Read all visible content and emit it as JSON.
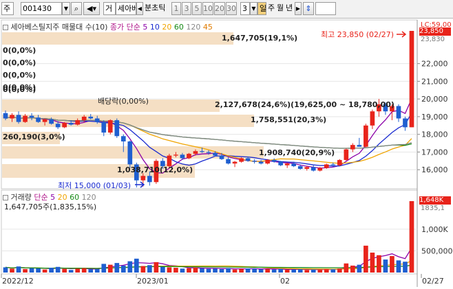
{
  "toolbar": {
    "market": "주",
    "code": "001430",
    "mode": "거",
    "name": "세아베",
    "period_label": "분초틱",
    "periods": [
      "1",
      "3",
      "5",
      "10",
      "20",
      "30"
    ],
    "period_value": "3",
    "day": "일",
    "week": "주",
    "month": "월",
    "year": "년"
  },
  "price_panel": {
    "legend_title": "세아베스틸지주 매물대 수(10)",
    "legend_ma_label": "종가 단순",
    "ma_periods": [
      {
        "label": "5",
        "color": "#8b00a8"
      },
      {
        "label": "10",
        "color": "#1a2bd0"
      },
      {
        "label": "20",
        "color": "#f0a400"
      },
      {
        "label": "60",
        "color": "#168a16"
      },
      {
        "label": "120",
        "color": "#888888"
      },
      {
        "label": "45",
        "color": "#e07b00"
      }
    ],
    "annotations": {
      "high": "최고 23,850 (02/27)",
      "low": "최저 15,000 (01/03)",
      "dividend": "배당락(0,00%)"
    },
    "zero_labels": [
      "0(0,0%)",
      "0(0,0%)",
      "0(0,0%)",
      "0(0,0%)",
      "0(0,0%)"
    ],
    "volume_profile": [
      {
        "label": "1,647,705(19,1%)"
      },
      {
        "label": "2,127,678(24,6%)(19,625,00 ~ 18,780,00)"
      },
      {
        "label": "1,758,551(20,3%)"
      },
      {
        "label": "260,190(3,0%)"
      },
      {
        "label": "1,908,740(20,9%)"
      },
      {
        "label": "1,038,710(12,0%)"
      }
    ],
    "y_ticks": [
      "22,000",
      "21,000",
      "20,000",
      "19,000",
      "18,000",
      "17,000",
      "16,000"
    ],
    "last_price_tag": "23,850",
    "ref_price_tag": "23,830",
    "top_partial_tag": "LC:59,00"
  },
  "volume_panel": {
    "legend_title": "거래량",
    "legend_ma_label": "단순",
    "ma_periods": [
      {
        "label": "5",
        "color": "#8b00a8"
      },
      {
        "label": "20",
        "color": "#f0a400"
      },
      {
        "label": "60",
        "color": "#168a16"
      },
      {
        "label": "120",
        "color": "#888888"
      }
    ],
    "value_line": "1,647,705주(1,835,15%)",
    "y_ticks": [
      "1,000K",
      "500,000"
    ],
    "last_volume_tag": "1,648K",
    "last_volume_pct_tag": "1835,1"
  },
  "x_axis": {
    "labels": [
      "2022/12",
      "2023/01",
      "02",
      "02/27"
    ]
  },
  "colors": {
    "up": "#e8241b",
    "down": "#1f5fd0",
    "profile": "#f5dfc4",
    "tag_red": "#e8241b"
  },
  "chart_data": {
    "type": "candlestick",
    "price_axis": {
      "min": 15000,
      "max": 23850
    },
    "candles": [
      {
        "o": 19200,
        "h": 19350,
        "l": 18800,
        "c": 18900
      },
      {
        "o": 18900,
        "h": 19200,
        "l": 18700,
        "c": 19100
      },
      {
        "o": 19100,
        "h": 19300,
        "l": 18600,
        "c": 18700
      },
      {
        "o": 18700,
        "h": 19150,
        "l": 18650,
        "c": 19050
      },
      {
        "o": 19050,
        "h": 19200,
        "l": 18800,
        "c": 18950
      },
      {
        "o": 18950,
        "h": 19100,
        "l": 18650,
        "c": 18700
      },
      {
        "o": 18700,
        "h": 18900,
        "l": 18500,
        "c": 18850
      },
      {
        "o": 18850,
        "h": 18950,
        "l": 18550,
        "c": 18600
      },
      {
        "o": 18600,
        "h": 18750,
        "l": 18300,
        "c": 18400
      },
      {
        "o": 18400,
        "h": 18700,
        "l": 18350,
        "c": 18650
      },
      {
        "o": 18650,
        "h": 18800,
        "l": 18500,
        "c": 18550
      },
      {
        "o": 18550,
        "h": 18900,
        "l": 18500,
        "c": 18800
      },
      {
        "o": 18800,
        "h": 19100,
        "l": 18700,
        "c": 19000
      },
      {
        "o": 19000,
        "h": 19150,
        "l": 18850,
        "c": 18900
      },
      {
        "o": 18900,
        "h": 19050,
        "l": 18600,
        "c": 18700
      },
      {
        "o": 18700,
        "h": 18800,
        "l": 17900,
        "c": 18100
      },
      {
        "o": 18100,
        "h": 18850,
        "l": 18000,
        "c": 18800
      },
      {
        "o": 18800,
        "h": 18900,
        "l": 17800,
        "c": 17900
      },
      {
        "o": 17900,
        "h": 18000,
        "l": 17000,
        "c": 17600
      },
      {
        "o": 17600,
        "h": 17650,
        "l": 16100,
        "c": 16300
      },
      {
        "o": 16300,
        "h": 16400,
        "l": 15000,
        "c": 15400
      },
      {
        "o": 15400,
        "h": 15800,
        "l": 15050,
        "c": 15650
      },
      {
        "o": 15650,
        "h": 15900,
        "l": 15100,
        "c": 15300
      },
      {
        "o": 15300,
        "h": 16600,
        "l": 15200,
        "c": 16500
      },
      {
        "o": 16500,
        "h": 16650,
        "l": 16050,
        "c": 16200
      },
      {
        "o": 16200,
        "h": 16900,
        "l": 16100,
        "c": 16800
      },
      {
        "o": 16800,
        "h": 17000,
        "l": 16700,
        "c": 16850
      },
      {
        "o": 16850,
        "h": 16950,
        "l": 16550,
        "c": 16650
      },
      {
        "o": 16650,
        "h": 16950,
        "l": 16600,
        "c": 16900
      },
      {
        "o": 16900,
        "h": 17150,
        "l": 16800,
        "c": 17050
      },
      {
        "o": 17050,
        "h": 17250,
        "l": 16950,
        "c": 17000
      },
      {
        "o": 17000,
        "h": 17100,
        "l": 16850,
        "c": 16950
      },
      {
        "o": 16950,
        "h": 17050,
        "l": 16750,
        "c": 16800
      },
      {
        "o": 16800,
        "h": 16950,
        "l": 16550,
        "c": 16600
      },
      {
        "o": 16600,
        "h": 16700,
        "l": 16300,
        "c": 16350
      },
      {
        "o": 16350,
        "h": 16500,
        "l": 16150,
        "c": 16450
      },
      {
        "o": 16450,
        "h": 16700,
        "l": 16400,
        "c": 16650
      },
      {
        "o": 16650,
        "h": 16750,
        "l": 16450,
        "c": 16500
      },
      {
        "o": 16500,
        "h": 16600,
        "l": 16350,
        "c": 16450
      },
      {
        "o": 16450,
        "h": 16550,
        "l": 16300,
        "c": 16350
      },
      {
        "o": 16350,
        "h": 16600,
        "l": 16300,
        "c": 16550
      },
      {
        "o": 16550,
        "h": 16650,
        "l": 16400,
        "c": 16450
      },
      {
        "o": 16450,
        "h": 16500,
        "l": 16200,
        "c": 16250
      },
      {
        "o": 16250,
        "h": 16400,
        "l": 16100,
        "c": 16350
      },
      {
        "o": 16350,
        "h": 16450,
        "l": 16150,
        "c": 16200
      },
      {
        "o": 16200,
        "h": 16300,
        "l": 16000,
        "c": 16050
      },
      {
        "o": 16050,
        "h": 16200,
        "l": 15950,
        "c": 16150
      },
      {
        "o": 16150,
        "h": 16250,
        "l": 15900,
        "c": 15950
      },
      {
        "o": 15950,
        "h": 16150,
        "l": 15900,
        "c": 16100
      },
      {
        "o": 16100,
        "h": 16350,
        "l": 16050,
        "c": 16300
      },
      {
        "o": 16300,
        "h": 16400,
        "l": 16150,
        "c": 16250
      },
      {
        "o": 16250,
        "h": 16600,
        "l": 16200,
        "c": 16550
      },
      {
        "o": 16550,
        "h": 17200,
        "l": 16500,
        "c": 17150
      },
      {
        "o": 17150,
        "h": 17500,
        "l": 17000,
        "c": 17400
      },
      {
        "o": 17400,
        "h": 17800,
        "l": 17300,
        "c": 17300
      },
      {
        "o": 17300,
        "h": 18600,
        "l": 17250,
        "c": 18500
      },
      {
        "o": 18500,
        "h": 19400,
        "l": 18300,
        "c": 19300
      },
      {
        "o": 19300,
        "h": 20000,
        "l": 19000,
        "c": 19700
      },
      {
        "o": 19700,
        "h": 19800,
        "l": 19100,
        "c": 19300
      },
      {
        "o": 19300,
        "h": 19700,
        "l": 18800,
        "c": 19600
      },
      {
        "o": 19600,
        "h": 19700,
        "l": 18700,
        "c": 18900
      },
      {
        "o": 18900,
        "h": 19000,
        "l": 18200,
        "c": 18400
      },
      {
        "o": 18400,
        "h": 23850,
        "l": 18400,
        "c": 23850
      }
    ],
    "volumes": [
      120,
      90,
      140,
      80,
      100,
      95,
      70,
      110,
      130,
      85,
      60,
      90,
      100,
      75,
      80,
      200,
      180,
      220,
      160,
      260,
      320,
      150,
      170,
      240,
      130,
      120,
      110,
      90,
      100,
      115,
      95,
      85,
      90,
      80,
      100,
      70,
      85,
      95,
      90,
      75,
      80,
      70,
      85,
      65,
      70,
      75,
      60,
      70,
      65,
      80,
      75,
      90,
      210,
      160,
      180,
      620,
      460,
      400,
      300,
      380,
      280,
      250,
      1648
    ],
    "volume_axis": {
      "min": 0,
      "max": 1648
    }
  }
}
